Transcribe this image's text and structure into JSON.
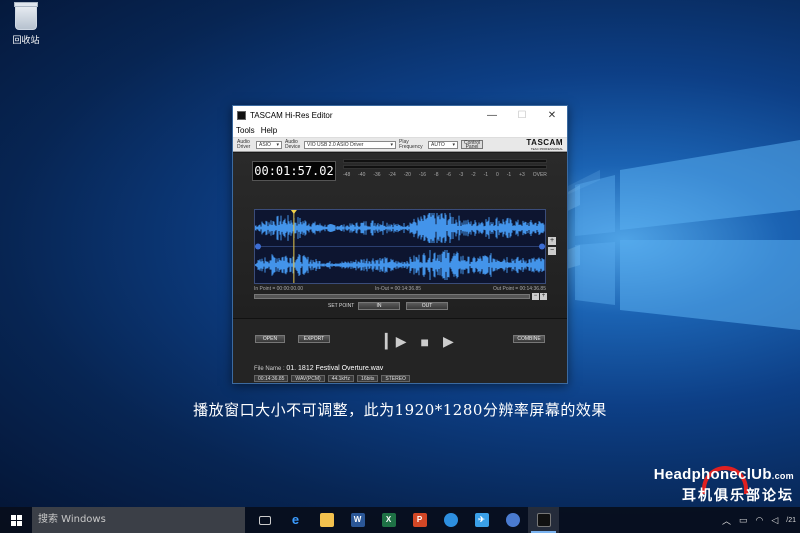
{
  "desktop": {
    "recycle_bin_label": "回收站",
    "caption": "播放窗口大小不可调整，此为1920*1280分辨率屏幕的效果"
  },
  "window": {
    "title": "TASCAM Hi-Res Editor",
    "menu": [
      "Tools",
      "Help"
    ],
    "settings": {
      "audio_driver_label": "Audio Driver",
      "audio_driver_value": "ASIO",
      "audio_device_label": "Audio Device",
      "audio_device_value": "VIO USB 2.0 ASIO Driver",
      "play_frequency_label": "Play Frequency",
      "play_frequency_value": "AUTO",
      "control_panel_label": "Control Panel",
      "brand": "TASCAM",
      "brand_sub": "TEAC PROFESSIONAL"
    },
    "timecode": "00:01:57.02",
    "meter_scale": [
      "-48",
      "-40",
      "-36",
      "-24",
      "-20",
      "-16",
      "-8",
      "-6",
      "-3",
      "-2",
      "-1",
      "0",
      "-1",
      "+3",
      "OVER"
    ],
    "in_point": "In Point = 00:00:00.00",
    "in_out": "In-Out = 00:14:36.85",
    "out_point": "Out Point = 00:14:36.85",
    "set_point_label": "SET POINT",
    "in_button": "IN",
    "out_button": "OUT",
    "open_button": "OPEN",
    "export_button": "EXPORT",
    "combine_button": "COMBINE",
    "file_name_label": "File Name :",
    "file_name": "01. 1812 Festival Overture.wav",
    "tags": [
      "00:14:36.85",
      "WAV(PCM)",
      "44.1kHz",
      "16bits",
      "STEREO"
    ],
    "playhead_fraction": 0.134
  },
  "taskbar": {
    "search_placeholder": "搜索 Windows",
    "apps": [
      "task-view",
      "edge",
      "file-explorer",
      "word",
      "excel",
      "powerpoint",
      "app-blue-1",
      "app-bird",
      "app-blue-2",
      "tascam-editor"
    ],
    "clock_tail": "/21"
  },
  "watermark": {
    "line1": "HeadphoneclUb",
    "domain": ".com",
    "line2": "耳机俱乐部论坛"
  }
}
